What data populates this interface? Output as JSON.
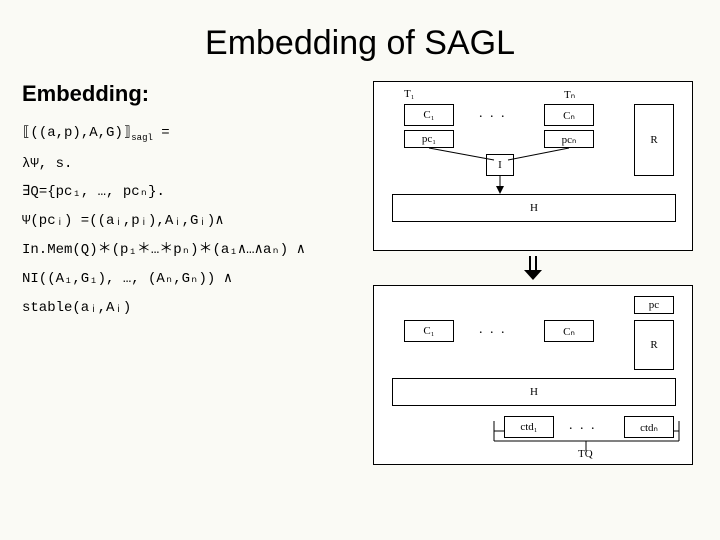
{
  "title": "Embedding of SAGL",
  "subhead": "Embedding:",
  "lines": {
    "l1_pre": "⟦((a,p),A,G)⟧",
    "l1_sub": "sagl",
    "l1_post": " =",
    "l2": "λΨ, s.",
    "l3": "∃Q={pc₁, …, pcₙ}.",
    "l4": "Ψ(pcᵢ) =((aᵢ,pᵢ),Aᵢ,Gᵢ)∧",
    "l5_pre": "In.Mem(Q)",
    "l5_star": "＊",
    "l5_p1": "(p₁",
    "l5_pm": "…",
    "l5_pn": "pₙ)",
    "l5_a": "(a₁∧…∧aₙ) ∧",
    "l6": "NI((A₁,G₁), …, (Aₙ,Gₙ)) ∧",
    "l7": "stable(aᵢ,Aᵢ)"
  },
  "diagram_top": {
    "T1": "T₁",
    "Tn": "Tₙ",
    "C1": "C₁",
    "Cn": "Cₙ",
    "pc1": "pc₁",
    "pcn": "pcₙ",
    "R": "R",
    "I": "I",
    "H": "H",
    "dots": ". . ."
  },
  "diagram_bot": {
    "pc": "pc",
    "C1": "C₁",
    "Cn": "Cₙ",
    "R": "R",
    "H": "H",
    "ctd1": "ctd₁",
    "ctdn": "ctdₙ",
    "TQ": "TQ",
    "dots": ". . ."
  }
}
